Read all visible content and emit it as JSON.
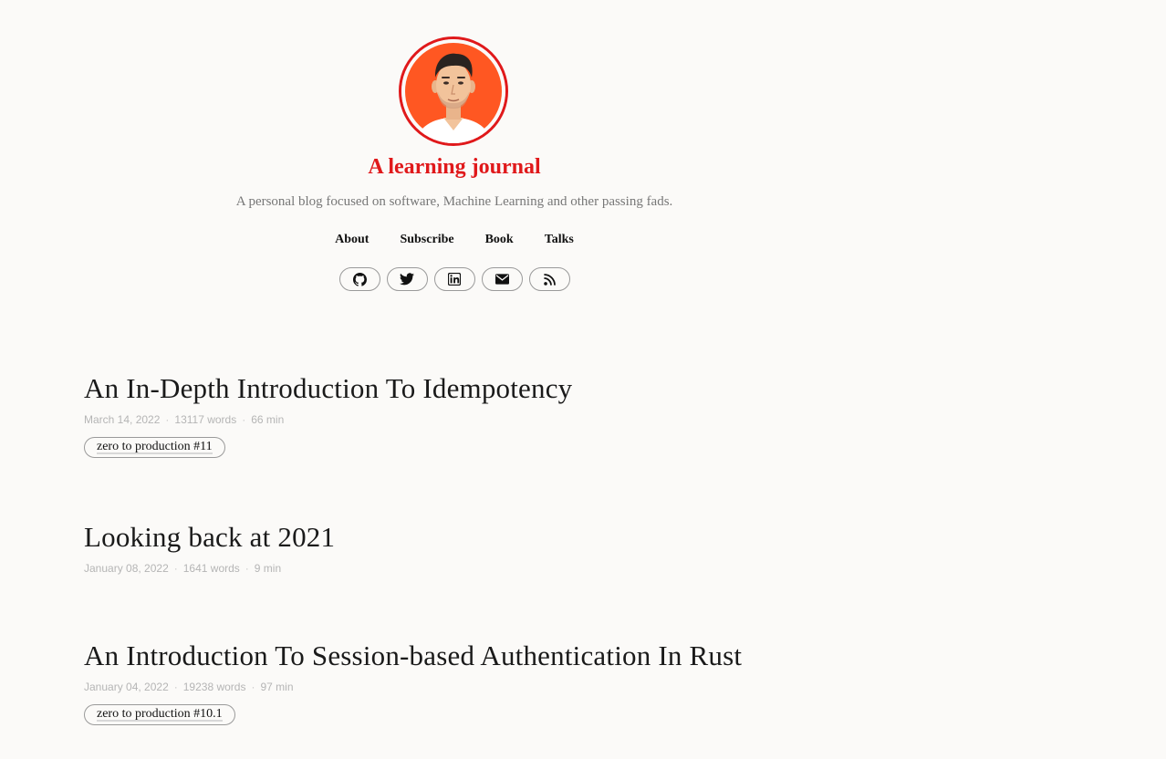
{
  "site": {
    "title": "A learning journal",
    "tagline": "A personal blog focused on software, Machine Learning and other passing fads."
  },
  "nav": {
    "items": [
      "About",
      "Subscribe",
      "Book",
      "Talks"
    ]
  },
  "social": {
    "icons": [
      "github-icon",
      "twitter-icon",
      "linkedin-icon",
      "envelope-icon",
      "rss-icon"
    ]
  },
  "colors": {
    "accent": "#e0191b",
    "avatar_bg": "#ff5722",
    "meta": "#b5b5b5"
  },
  "posts": [
    {
      "title": "An In-Depth Introduction To Idempotency",
      "date": "March 14, 2022",
      "words": "13117 words",
      "read_time": "66 min",
      "tag": "zero to production #11"
    },
    {
      "title": "Looking back at 2021",
      "date": "January 08, 2022",
      "words": "1641 words",
      "read_time": "9 min",
      "tag": ""
    },
    {
      "title": "An Introduction To Session-based Authentication In Rust",
      "date": "January 04, 2022",
      "words": "19238 words",
      "read_time": "97 min",
      "tag": "zero to production #10.1"
    }
  ]
}
